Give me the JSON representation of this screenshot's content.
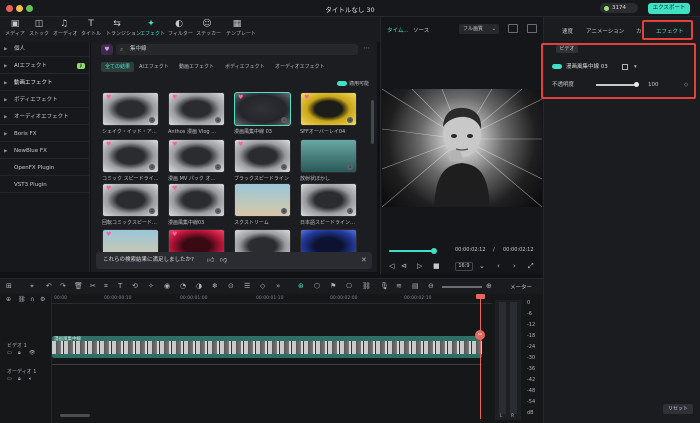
{
  "window": {
    "title": "タイトルなし 30"
  },
  "header": {
    "credits": "3174",
    "export_label": "エクスポート"
  },
  "toolbar": {
    "items": [
      {
        "label": "メディア",
        "icon": "media-icon"
      },
      {
        "label": "ストック",
        "icon": "stock-icon"
      },
      {
        "label": "オーディオ",
        "icon": "audio-icon"
      },
      {
        "label": "タイトル",
        "icon": "title-icon"
      },
      {
        "label": "トランジション",
        "icon": "transition-icon"
      },
      {
        "label": "エフェクト",
        "icon": "effects-icon"
      },
      {
        "label": "フィルター",
        "icon": "filter-icon"
      },
      {
        "label": "ステッカー",
        "icon": "sticker-icon"
      },
      {
        "label": "テンプレート",
        "icon": "template-icon"
      }
    ]
  },
  "sidebar": {
    "items": [
      {
        "label": "個人"
      },
      {
        "label": "AIエフェクト",
        "badge": "β"
      },
      {
        "label": "動画エフェクト"
      },
      {
        "label": "ボディエフェクト"
      },
      {
        "label": "オーディオエフェクト"
      },
      {
        "label": "Boris FX"
      },
      {
        "label": "NewBlue FX"
      },
      {
        "label": "OpenFX Plugin"
      },
      {
        "label": "VST3 Plugin"
      }
    ]
  },
  "library": {
    "search_value": "集中線",
    "categories": [
      "全ての結果",
      "AIエフェクト",
      "動画エフェクト",
      "ボディエフェクト",
      "オーディオエフェクト"
    ],
    "favorites_toggle": "適用可能",
    "cards": [
      {
        "name": "シェイク・イッド・ア…",
        "style": "speed"
      },
      {
        "name": "Anthos 漫画 Vlog …",
        "style": "speed"
      },
      {
        "name": "漫画風集中線 03",
        "style": "dark"
      },
      {
        "name": "SFFオーバーレイ04",
        "style": "yellow"
      },
      {
        "name": "コミック スピードライ…",
        "style": "speed"
      },
      {
        "name": "漫画 MV パック オ…",
        "style": "speed"
      },
      {
        "name": "ブラックスピードライン",
        "style": "speed"
      },
      {
        "name": "放射状ぼかし",
        "style": "teal"
      },
      {
        "name": "回転コミックスピード…",
        "style": "speed"
      },
      {
        "name": "漫画風集中線03",
        "style": "speed"
      },
      {
        "name": "スクストリーム",
        "style": "sky"
      },
      {
        "name": "日本語スピードライン…",
        "style": "speed"
      },
      {
        "name": "",
        "style": "sky"
      },
      {
        "name": "",
        "style": "red"
      },
      {
        "name": "",
        "style": "speed"
      },
      {
        "name": "",
        "style": "navy"
      }
    ],
    "feedback": "これらの検索結果に満足しましたか?"
  },
  "player": {
    "tabs": [
      "タイム...",
      "ソース"
    ],
    "quality": "フル画質",
    "current_time": "00:00:02:12",
    "total_time": "00:00:02:12",
    "ratio": "16:9",
    "progress": 1.0
  },
  "right_panel": {
    "tabs": [
      "速度",
      "アニメーション",
      "カ",
      "エフェクト"
    ],
    "section": "ビデオ",
    "effect_name": "漫画風集中線 03",
    "opacity_label": "不透明度",
    "opacity_value": "100",
    "reset_label": "リセット"
  },
  "timeline": {
    "meter_label": "メーター",
    "ruler_ticks": [
      "00:00",
      "00:00:00:10",
      "00:00:01:00",
      "00:00:01:10",
      "00:00:02:00",
      "00:00:02:10"
    ],
    "tracks": [
      {
        "label": "ビデオ 1"
      },
      {
        "label": "オーディオ 1"
      }
    ],
    "clip_label": "漫画風集中線",
    "meter_scale": [
      "0",
      "-6",
      "-12",
      "-18",
      "-24",
      "-30",
      "-36",
      "-42",
      "-48",
      "-54",
      "dB"
    ],
    "meter_channels": [
      "L",
      "R"
    ]
  },
  "colors": {
    "accent": "#3fe0c5",
    "highlight": "#e0413c",
    "playhead": "#e8655e"
  }
}
